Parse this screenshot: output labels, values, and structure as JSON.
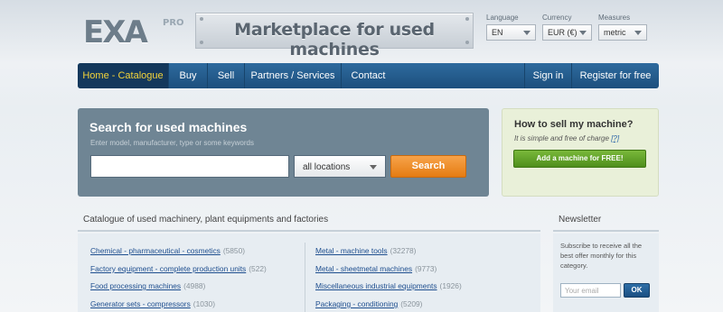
{
  "header": {
    "logo_text": "EXA",
    "logo_suffix": "PRO",
    "banner_text": "Marketplace for used machines",
    "selectors": [
      {
        "label": "Language",
        "value": "EN"
      },
      {
        "label": "Currency",
        "value": "EUR (€)"
      },
      {
        "label": "Measures",
        "value": "metric"
      }
    ]
  },
  "nav": {
    "items": [
      {
        "label": "Home - Catalogue"
      },
      {
        "label": "Buy"
      },
      {
        "label": "Sell"
      },
      {
        "label": "Partners / Services"
      },
      {
        "label": "Contact"
      }
    ],
    "right_items": [
      {
        "label": "Sign in"
      },
      {
        "label": "Register for free"
      }
    ]
  },
  "search": {
    "title": "Search for used machines",
    "hint": "Enter model, manufacturer, type or some keywords",
    "input_value": "",
    "location_value": "all locations",
    "button_label": "Search"
  },
  "sell": {
    "title": "How to sell my machine?",
    "subtitle": "It is simple and free of charge",
    "help_link": "[?]",
    "button_label": "Add a machine for FREE!"
  },
  "catalogue": {
    "title": "Catalogue of used machinery, plant equipments and factories",
    "left": [
      {
        "label": "Chemical - pharmaceutical - cosmetics",
        "count": "(5850)"
      },
      {
        "label": "Factory equipment - complete production units",
        "count": "(522)"
      },
      {
        "label": "Food processing machines",
        "count": "(4988)"
      },
      {
        "label": "Generator sets - compressors",
        "count": "(1030)"
      }
    ],
    "right": [
      {
        "label": "Metal - machine tools",
        "count": "(32278)"
      },
      {
        "label": "Metal - sheetmetal machines",
        "count": "(9773)"
      },
      {
        "label": "Miscellaneous industrial equipments",
        "count": "(1926)"
      },
      {
        "label": "Packaging - conditioning",
        "count": "(5209)"
      }
    ]
  },
  "newsletter": {
    "title": "Newsletter",
    "text": "Subscribe to receive all the best offer monthly for this category.",
    "input_placeholder": "Your email",
    "button_label": "OK"
  },
  "colors": {
    "nav_bg": "#1c4f7d",
    "nav_active_text": "#f3d33a",
    "search_panel": "#6f8594",
    "search_button": "#e57c12",
    "sell_button": "#4f8f1c",
    "link": "#1f4f8f"
  }
}
